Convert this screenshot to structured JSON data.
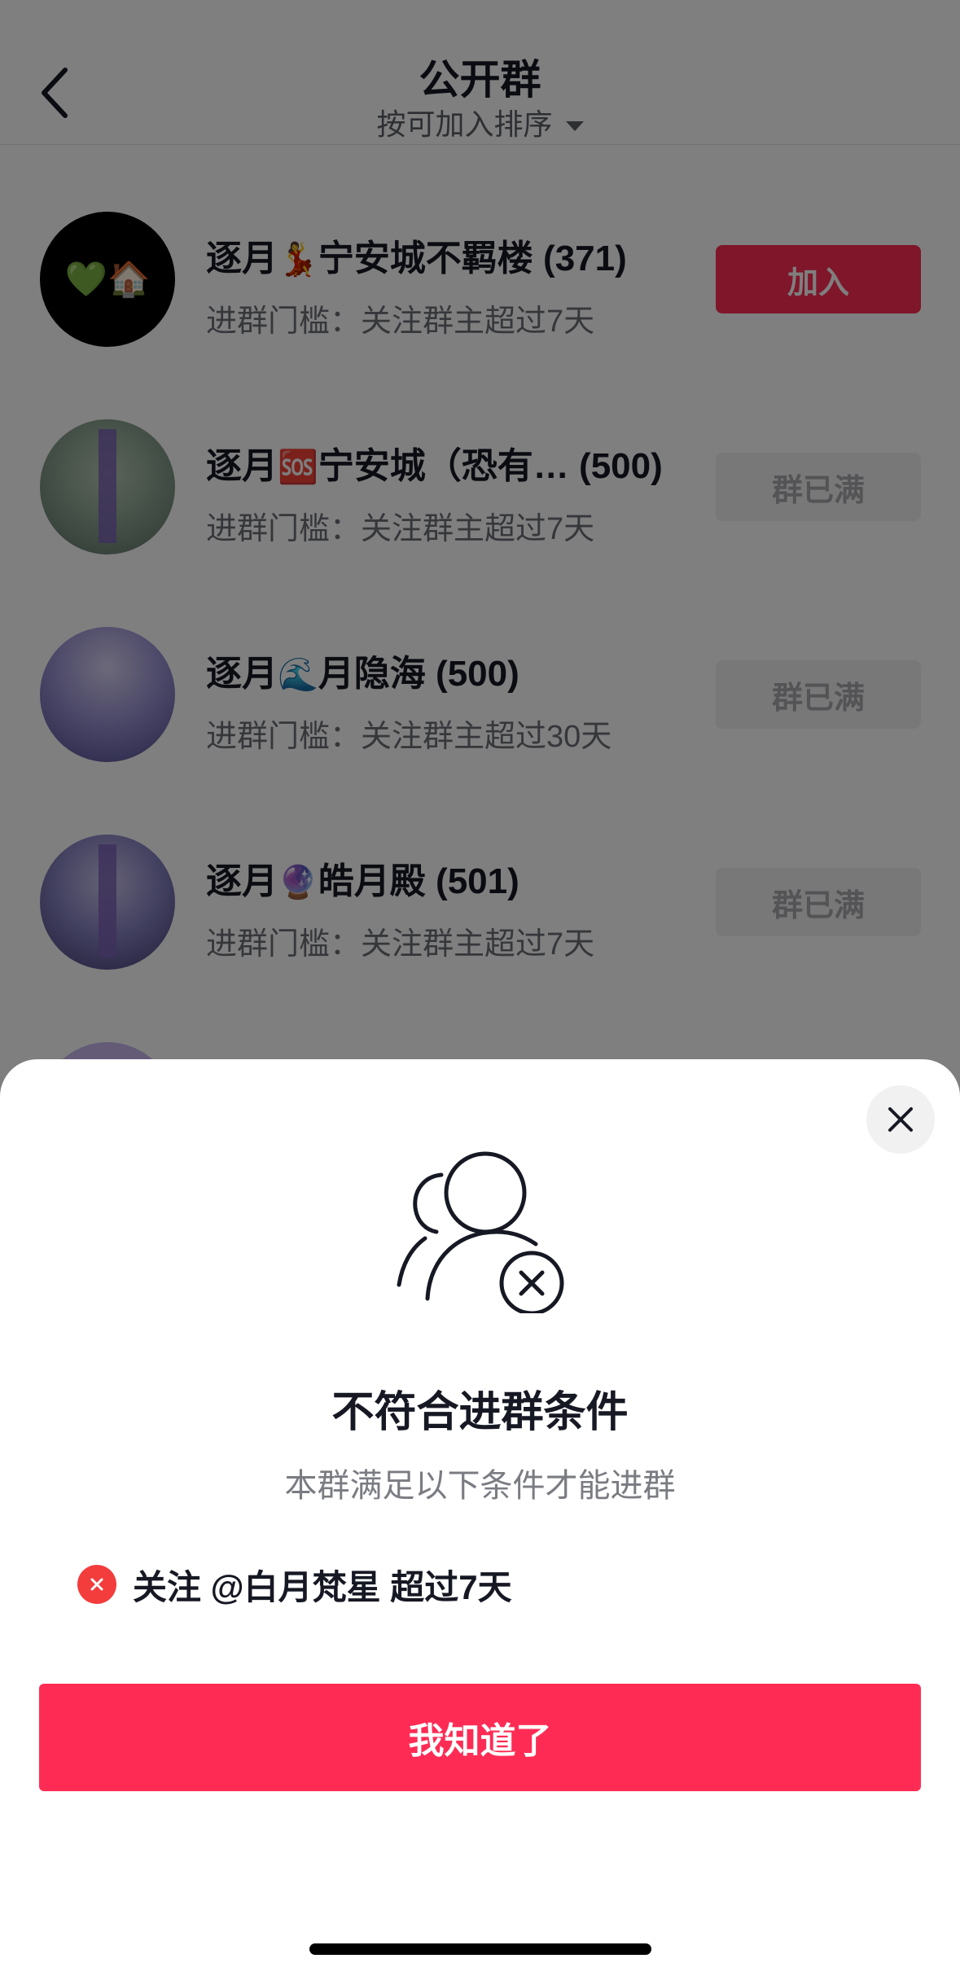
{
  "header": {
    "title": "公开群",
    "sort_label": "按可加入排序"
  },
  "groups": [
    {
      "name": "逐月",
      "emoji": "💃",
      "name_rest": "宁安城不羁楼 (371)",
      "threshold": "进群门槛：关注群主超过7天",
      "button": "加入",
      "avatar_emoji": "💚🏠"
    },
    {
      "name": "逐月",
      "emoji": "🆘",
      "name_rest": "宁安城（恐有… (500)",
      "threshold": "进群门槛：关注群主超过7天",
      "button": "群已满"
    },
    {
      "name": "逐月",
      "emoji": "🌊",
      "name_rest": "月隐海 (500)",
      "threshold": "进群门槛：关注群主超过30天",
      "button": "群已满"
    },
    {
      "name": "逐月",
      "emoji": "🔮",
      "name_rest": "皓月殿 (501)",
      "threshold": "进群门槛：关注群主超过7天",
      "button": "群已满"
    }
  ],
  "sheet": {
    "title": "不符合进群条件",
    "subtitle": "本群满足以下条件才能进群",
    "condition": "关注 @白月梵星 超过7天",
    "confirm_label": "我知道了"
  },
  "icons": {
    "back": "chevron-left-icon",
    "sort": "caret-down-icon",
    "close": "close-icon",
    "hero": "users-blocked-icon",
    "condition": "error-x-icon"
  },
  "colors": {
    "accent": "#fe2c55",
    "error": "#f33c3c",
    "disabled_bg": "#f1f1f2",
    "disabled_text": "#a8a9ad"
  }
}
